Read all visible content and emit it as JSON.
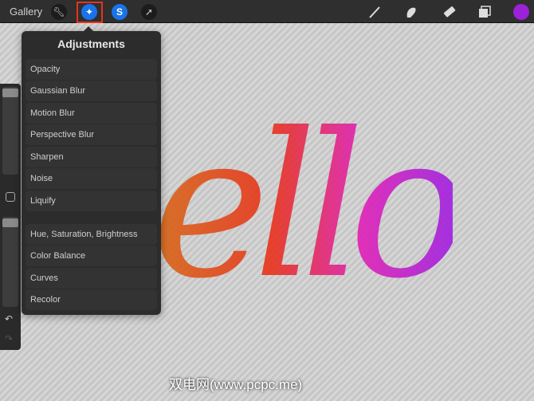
{
  "topbar": {
    "gallery_label": "Gallery",
    "selected_tool": "adjustments",
    "color_swatch": "#9b22d6",
    "accent": "#1a73e8"
  },
  "canvas": {
    "artwork_text": "ello"
  },
  "adjustments": {
    "title": "Adjustments",
    "group1": [
      "Opacity",
      "Gaussian Blur",
      "Motion Blur",
      "Perspective Blur",
      "Sharpen",
      "Noise",
      "Liquify"
    ],
    "group2": [
      "Hue, Saturation, Brightness",
      "Color Balance",
      "Curves",
      "Recolor"
    ]
  },
  "watermark": "双电网(www.pcpc.me)"
}
